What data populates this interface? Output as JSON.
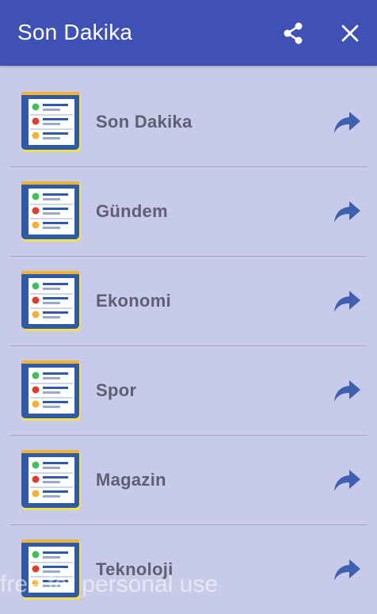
{
  "appbar": {
    "title": "Son Dakika",
    "share_icon": "share-icon",
    "close_icon": "close-icon",
    "color": "#3f51b5"
  },
  "list": {
    "items": [
      {
        "label": "Son Dakika",
        "icon": "news-list-icon",
        "action_icon": "forward-arrow-icon"
      },
      {
        "label": "Gündem",
        "icon": "news-list-icon",
        "action_icon": "forward-arrow-icon"
      },
      {
        "label": "Ekonomi",
        "icon": "news-list-icon",
        "action_icon": "forward-arrow-icon"
      },
      {
        "label": "Spor",
        "icon": "news-list-icon",
        "action_icon": "forward-arrow-icon"
      },
      {
        "label": "Magazin",
        "icon": "news-list-icon",
        "action_icon": "forward-arrow-icon"
      },
      {
        "label": "Teknoloji",
        "icon": "news-list-icon",
        "action_icon": "forward-arrow-icon"
      }
    ]
  },
  "watermark": "free for personal use",
  "colors": {
    "background": "#c7cae8",
    "label": "#5d6072",
    "arrow": "#3f5fb0"
  }
}
